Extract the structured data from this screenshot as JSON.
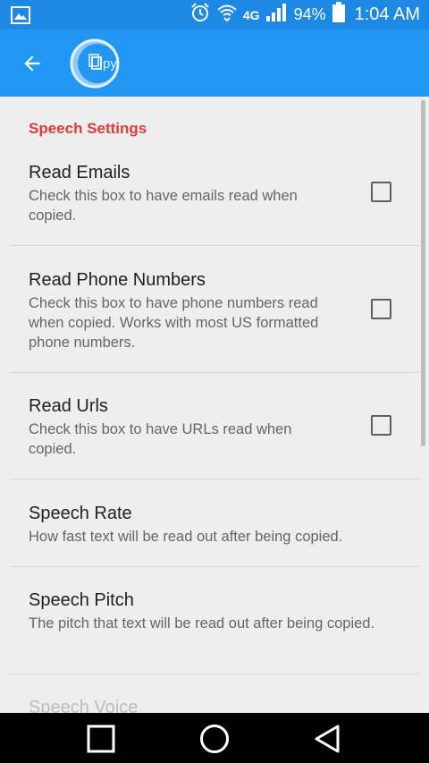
{
  "status_bar": {
    "network": "4G",
    "battery": "94%",
    "time": "1:04 AM"
  },
  "app_bar": {
    "logo_text": "Copy",
    "colors": {
      "status": "#1e88e5",
      "toolbar": "#2196f3"
    }
  },
  "settings": {
    "category": "Speech Settings",
    "items": [
      {
        "title": "Read Emails",
        "summary": "Check this box to have emails read when copied.",
        "checked": false
      },
      {
        "title": "Read Phone Numbers",
        "summary": "Check this box to have phone numbers read when copied. Works with most US formatted phone numbers.",
        "checked": false
      },
      {
        "title": "Read Urls",
        "summary": "Check this box to have URLs read when copied.",
        "checked": false
      },
      {
        "title": "Speech Rate",
        "summary": "How fast text will be read out after being copied."
      },
      {
        "title": "Speech Pitch",
        "summary": "The pitch that text will be read out after being copied."
      },
      {
        "title": "Speech Voice"
      }
    ]
  },
  "icons": {
    "back": "arrow-back-icon",
    "nav_recent": "square-icon",
    "nav_home": "circle-icon",
    "nav_back": "triangle-icon"
  }
}
